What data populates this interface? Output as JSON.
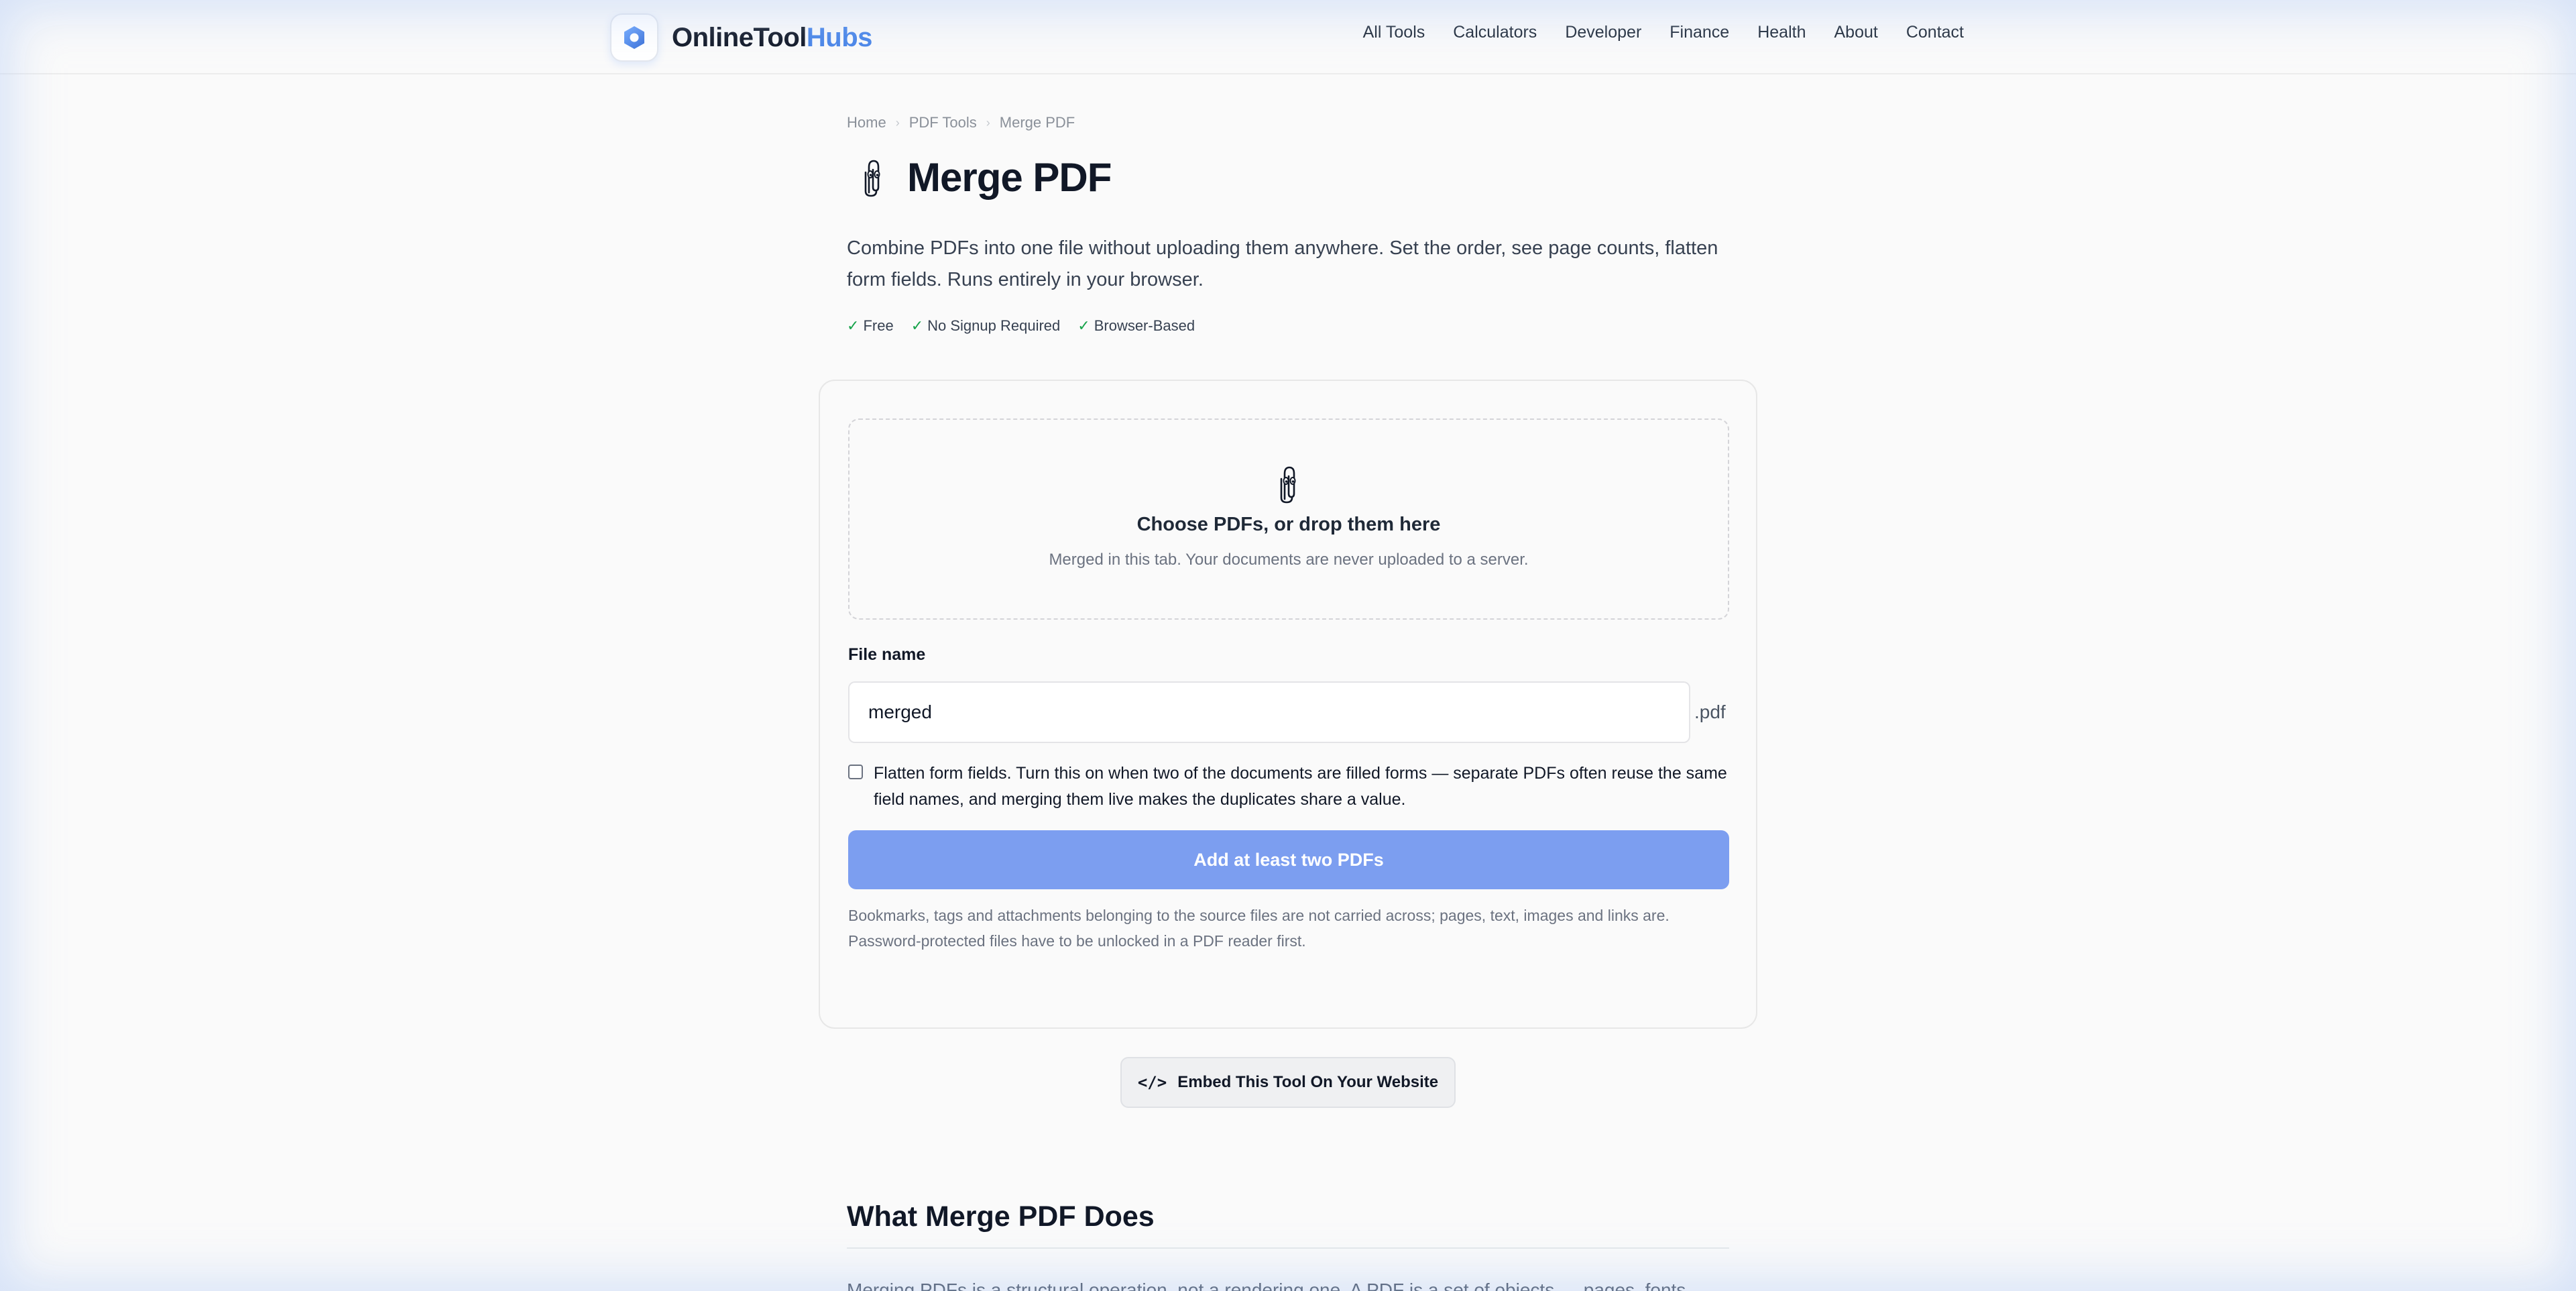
{
  "header": {
    "logo_text_main": "OnlineTool",
    "logo_text_accent": "Hubs",
    "nav": [
      "All Tools",
      "Calculators",
      "Developer",
      "Finance",
      "Health",
      "About",
      "Contact"
    ]
  },
  "breadcrumb": [
    "Home",
    "PDF Tools",
    "Merge PDF"
  ],
  "page": {
    "title": "Merge PDF",
    "description": "Combine PDFs into one file without uploading them anywhere. Set the order, see page counts, flatten form fields. Runs entirely in your browser.",
    "badges": [
      "Free",
      "No Signup Required",
      "Browser-Based"
    ]
  },
  "tool": {
    "dropzone_title": "Choose PDFs, or drop them here",
    "dropzone_subtitle": "Merged in this tab. Your documents are never uploaded to a server.",
    "file_name_label": "File name",
    "file_name_value": "merged",
    "file_ext": ".pdf",
    "flatten_label": "Flatten form fields. Turn this on when two of the documents are filled forms — separate PDFs often reuse the same field names, and merging them live makes the duplicates share a value.",
    "flatten_checked": false,
    "submit_label": "Add at least two PDFs",
    "note": "Bookmarks, tags and attachments belonging to the source files are not carried across; pages, text, images and links are. Password-protected files have to be unlocked in a PDF reader first."
  },
  "embed": {
    "icon": "</>",
    "label": "Embed This Tool On Your Website"
  },
  "section": {
    "title": "What Merge PDF Does",
    "text": "Merging PDFs is a structural operation, not a rendering one. A PDF is a set of objects — pages, fonts"
  },
  "colors": {
    "accent": "#4a86e8",
    "button": "#7c9ef0",
    "check": "#16a34a"
  }
}
